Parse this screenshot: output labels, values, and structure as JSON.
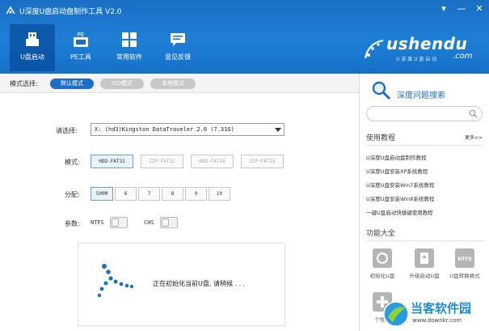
{
  "window": {
    "title": "U深度U盘启动盘制作工具 V2.0",
    "controls": [
      "▾",
      "—",
      "✕"
    ]
  },
  "nav": {
    "tabs": [
      {
        "label": "U盘启动",
        "icon": "usb-drive-icon",
        "active": true
      },
      {
        "label": "PE工具",
        "icon": "pe-tool-icon",
        "badge": "PE",
        "active": false
      },
      {
        "label": "常用软件",
        "icon": "apps-grid-icon",
        "active": false
      },
      {
        "label": "意见反馈",
        "icon": "feedback-icon",
        "active": false
      }
    ]
  },
  "brand": {
    "name": "ushendu",
    "sub": "U 深 度 U 盘 启 动",
    "com": ".com"
  },
  "modebar": {
    "label": "模式选择:",
    "modes": [
      {
        "label": "默认模式",
        "active": true
      },
      {
        "label": "ISO模式",
        "active": false
      },
      {
        "label": "本地模式",
        "active": false
      }
    ]
  },
  "form": {
    "select_label": "请选择:",
    "select_value": "X: (hd3)Kingston DataTraveler 2.0 (7.31G)",
    "mode_label": "模式:",
    "mode_options": [
      "HDD-FAT32",
      "ZIP-FAT32",
      "HDD-FAT16",
      "ZIP-FAT16"
    ],
    "alloc_label": "分配:",
    "alloc_options": [
      "500M",
      "6",
      "7",
      "8",
      "9",
      "10"
    ],
    "param_label": "参数:",
    "ntfs_label": "NTFS",
    "chs_label": "CHS"
  },
  "progress": {
    "text": "正在初始化当前U盘, 请稍候 . . ."
  },
  "right": {
    "search_title": "深度问题搜索",
    "search_placeholder": "",
    "tutorial_title": "使用教程",
    "more": "更多>>",
    "tutorials": [
      "U深度U盘启动盘制作教程",
      "U深度U盘安装XP系统教程",
      "U深度U盘安装Win7系统教程",
      "U深度U盘安装Win8系统教程",
      "一键U盘启动快捷键使用教程"
    ],
    "tools_title": "功能大全",
    "tools": [
      {
        "label": "初始化U盘",
        "icon": "format-usb-icon"
      },
      {
        "label": "升级启动U盘",
        "icon": "upgrade-usb-icon"
      },
      {
        "label": "U盘转换格式",
        "icon": "ntfs-convert-icon",
        "badge": "NTFS"
      },
      {
        "label": "个性化",
        "icon": "personalize-icon"
      }
    ]
  },
  "watermark": {
    "text": "当客软件园",
    "url": "www.downkr.com"
  }
}
